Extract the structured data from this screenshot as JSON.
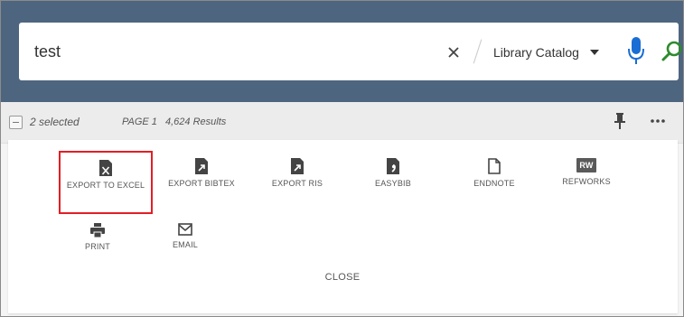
{
  "search": {
    "query": "test",
    "scope": "Library Catalog",
    "icons": {
      "clear": "close-icon",
      "scope_dropdown": "chevron-down-icon",
      "voice": "microphone-icon",
      "submit": "search-icon"
    }
  },
  "results_bar": {
    "selected": "2 selected",
    "page": "PAGE 1",
    "count": "4,624 Results",
    "icons": {
      "pin": "pin-icon",
      "more": "more-icon"
    }
  },
  "export_panel": {
    "actions": [
      {
        "id": "export-excel",
        "label": "EXPORT TO EXCEL",
        "icon": "excel-file-icon",
        "highlighted": true
      },
      {
        "id": "export-bibtex",
        "label": "EXPORT BIBTEX",
        "icon": "bibtex-file-icon"
      },
      {
        "id": "export-ris",
        "label": "EXPORT RIS",
        "icon": "ris-file-icon"
      },
      {
        "id": "easybib",
        "label": "EASYBIB",
        "icon": "easybib-icon"
      },
      {
        "id": "endnote",
        "label": "ENDNOTE",
        "icon": "endnote-icon"
      },
      {
        "id": "refworks",
        "label": "REFWORKS",
        "icon": "refworks-icon",
        "badge": "RW"
      },
      {
        "id": "print",
        "label": "PRINT",
        "icon": "printer-icon"
      },
      {
        "id": "email",
        "label": "EMAIL",
        "icon": "envelope-icon"
      }
    ],
    "close_label": "CLOSE"
  },
  "colors": {
    "header_bg": "#4e6580",
    "accent_blue": "#1a6dd4",
    "search_green": "#2e8b2e",
    "highlight_red": "#e31e24",
    "panel_bg": "#ffffff"
  }
}
